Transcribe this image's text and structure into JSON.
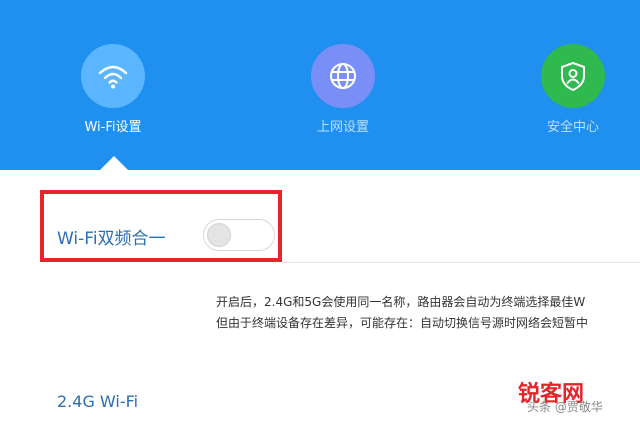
{
  "nav": {
    "items": [
      {
        "label": "Wi-Fi设置",
        "icon": "wifi-icon",
        "active": true
      },
      {
        "label": "上网设置",
        "icon": "globe-icon",
        "active": false
      },
      {
        "label": "安全中心",
        "icon": "shield-user-icon",
        "active": false
      }
    ]
  },
  "colors": {
    "header_bg": "#1f8ff0",
    "wifi_icon_bg": "#5cb6ff",
    "net_icon_bg": "#7a8ef7",
    "security_icon_bg": "#2fb94e",
    "highlight": "#e5252a",
    "label": "#2c6fb2"
  },
  "dual_band": {
    "label": "Wi-Fi双频合一",
    "enabled": false
  },
  "description": {
    "line1": "开启后，2.4G和5G会使用同一名称，路由器会自动为终端选择最佳W",
    "line2": "但由于终端设备存在差异，可能存在：自动切换信号源时网络会短暂中"
  },
  "section": {
    "title": "2.4G Wi-Fi"
  },
  "watermark": {
    "logo": "锐客网",
    "author": "头条 @贾敬华"
  }
}
